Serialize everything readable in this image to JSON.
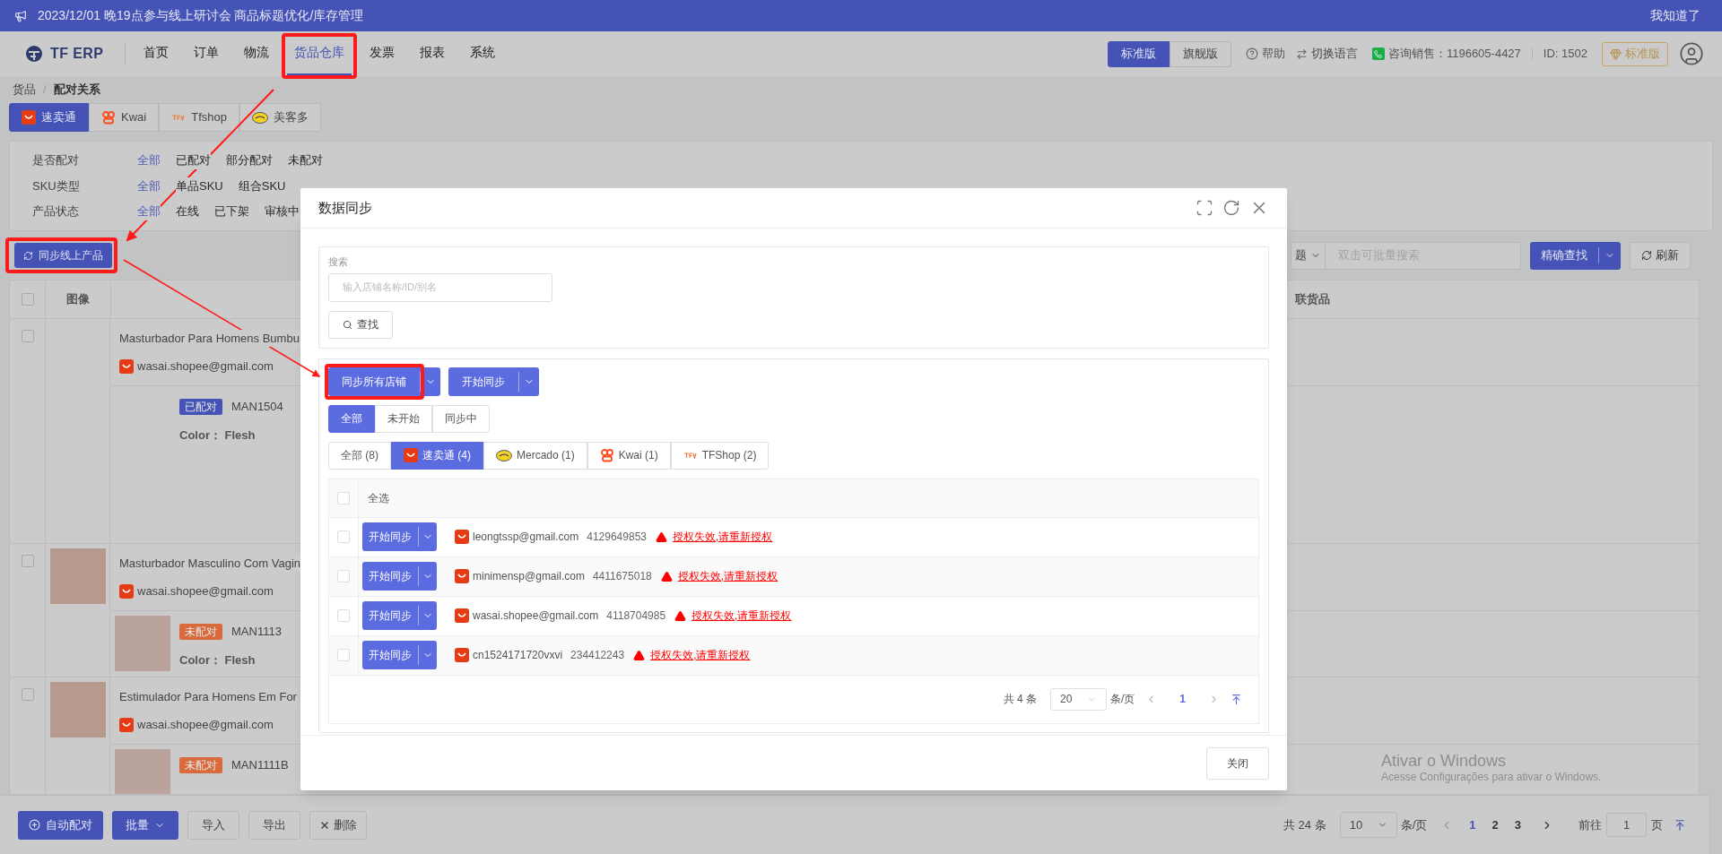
{
  "announcement": {
    "text": "2023/12/01 晚19点参与线上研讨会 商品标题优化/库存管理",
    "dismiss": "我知道了"
  },
  "header": {
    "logo": "TF ERP",
    "nav": [
      {
        "label": "首页",
        "selected": false
      },
      {
        "label": "订单",
        "selected": false
      },
      {
        "label": "物流",
        "selected": false
      },
      {
        "label": "货品仓库",
        "selected": true
      },
      {
        "label": "发票",
        "selected": false
      },
      {
        "label": "报表",
        "selected": false
      },
      {
        "label": "系统",
        "selected": false
      }
    ],
    "editions": [
      {
        "label": "标准版",
        "selected": true
      },
      {
        "label": "旗舰版",
        "selected": false
      }
    ],
    "help": "帮助",
    "language": "切换语言",
    "sales_contact": "咨询销售：1196605-4427",
    "account_id": "ID: 1502",
    "plan_badge": "标准版"
  },
  "breadcrumb": {
    "items": [
      "货品",
      "配对关系"
    ],
    "separator": "/"
  },
  "platform_tabs": [
    {
      "label": "速卖通",
      "kind": "aliexpress",
      "selected": true
    },
    {
      "label": "Kwai",
      "kind": "kwai",
      "selected": false
    },
    {
      "label": "Tfshop",
      "kind": "tfshop",
      "selected": false
    },
    {
      "label": "美客多",
      "kind": "mercado",
      "selected": false
    }
  ],
  "filters": [
    {
      "label": "是否配对",
      "options": [
        {
          "label": "全部",
          "selected": true
        },
        {
          "label": "已配对",
          "selected": false
        },
        {
          "label": "部分配对",
          "selected": false
        },
        {
          "label": "未配对",
          "selected": false
        }
      ]
    },
    {
      "label": "SKU类型",
      "options": [
        {
          "label": "全部",
          "selected": true
        },
        {
          "label": "单品SKU",
          "selected": false
        },
        {
          "label": "组合SKU",
          "selected": false
        }
      ]
    },
    {
      "label": "产品状态",
      "options": [
        {
          "label": "全部",
          "selected": true
        },
        {
          "label": "在线",
          "selected": false
        },
        {
          "label": "已下架",
          "selected": false
        },
        {
          "label": "审核中",
          "selected": false
        }
      ]
    }
  ],
  "toolbar": {
    "sync_button": "同步线上产品",
    "search_field_select": "题",
    "search_placeholder": "双击可批量搜索",
    "exact_search": "精确查找",
    "refresh": "刷新"
  },
  "table": {
    "columns": [
      "图像",
      "联货品"
    ],
    "header_checked": false,
    "rows": [
      {
        "checked": false,
        "photo": false,
        "title": "Masturbador Para Homens Bumbu",
        "shop": "wasai.shopee@gmail.com",
        "variant": {
          "status": {
            "kind": "matched",
            "label": "已配对"
          },
          "sku": "MAN1504",
          "attribute": "Color： Flesh"
        }
      },
      {
        "checked": false,
        "photo": true,
        "title": "Masturbador Masculino Com Vagin",
        "shop": "wasai.shopee@gmail.com",
        "variant": {
          "photo": true,
          "status": {
            "kind": "unmatched",
            "label": "未配对"
          },
          "sku": "MAN1113",
          "attribute": "Color： Flesh"
        }
      },
      {
        "checked": false,
        "photo": true,
        "title": "Estimulador Para Homens Em For",
        "shop": "wasai.shopee@gmail.com",
        "variant": {
          "photo": true,
          "status": {
            "kind": "unmatched",
            "label": "未配对"
          },
          "sku": "MAN1111B"
        }
      }
    ]
  },
  "bottom_bar": {
    "auto_match": "自动配对",
    "batch": "批量",
    "import": "导入",
    "export": "导出",
    "delete": "删除",
    "total": "共 24 条",
    "page_size": "10",
    "per_page": "条/页",
    "pages": [
      {
        "label": "1",
        "selected": true
      },
      {
        "label": "2",
        "selected": false
      },
      {
        "label": "3",
        "selected": false
      }
    ],
    "goto": "前往",
    "goto_value": "1",
    "page_unit": "页"
  },
  "os_notice": {
    "title": "Ativar o Windows",
    "text": "Acesse Configurações para ativar o Windows."
  },
  "dialog": {
    "title": "数据同步",
    "search_label": "搜索",
    "search_placeholder": "输入店铺名称/ID/别名",
    "search_button": "查找",
    "actions": [
      "同步所有店铺",
      "开始同步"
    ],
    "status_tabs": [
      {
        "label": "全部",
        "selected": true
      },
      {
        "label": "未开始",
        "selected": false
      },
      {
        "label": "同步中",
        "selected": false
      }
    ],
    "platform_tabs": [
      {
        "label": "全部 (8)",
        "kind": "all",
        "selected": false
      },
      {
        "label": "速卖通 (4)",
        "kind": "aliexpress",
        "selected": true
      },
      {
        "label": "Mercado (1)",
        "kind": "mercado",
        "selected": false
      },
      {
        "label": "Kwai (1)",
        "kind": "kwai",
        "selected": false
      },
      {
        "label": "TFShop (2)",
        "kind": "tfshop",
        "selected": false
      }
    ],
    "select_all": "全选",
    "select_all_checked": false,
    "rows": [
      {
        "checked": false,
        "action": "开始同步",
        "shop": "leongtssp@gmail.com",
        "shop_id": "4129649853",
        "error": "授权失效,请重新授权"
      },
      {
        "checked": false,
        "action": "开始同步",
        "shop": "minimensp@gmail.com",
        "shop_id": "4411675018",
        "error": "授权失效,请重新授权"
      },
      {
        "checked": false,
        "action": "开始同步",
        "shop": "wasai.shopee@gmail.com",
        "shop_id": "4118704985",
        "error": "授权失效,请重新授权"
      },
      {
        "checked": false,
        "action": "开始同步",
        "shop": "cn1524171720vxvi",
        "shop_id": "234412243",
        "error": "授权失效,请重新授权"
      }
    ],
    "pagination": {
      "total": "共 4 条",
      "page_size": "20",
      "per_page": "条/页",
      "pages": [
        {
          "label": "1",
          "selected": true
        }
      ]
    },
    "close": "关闭"
  }
}
